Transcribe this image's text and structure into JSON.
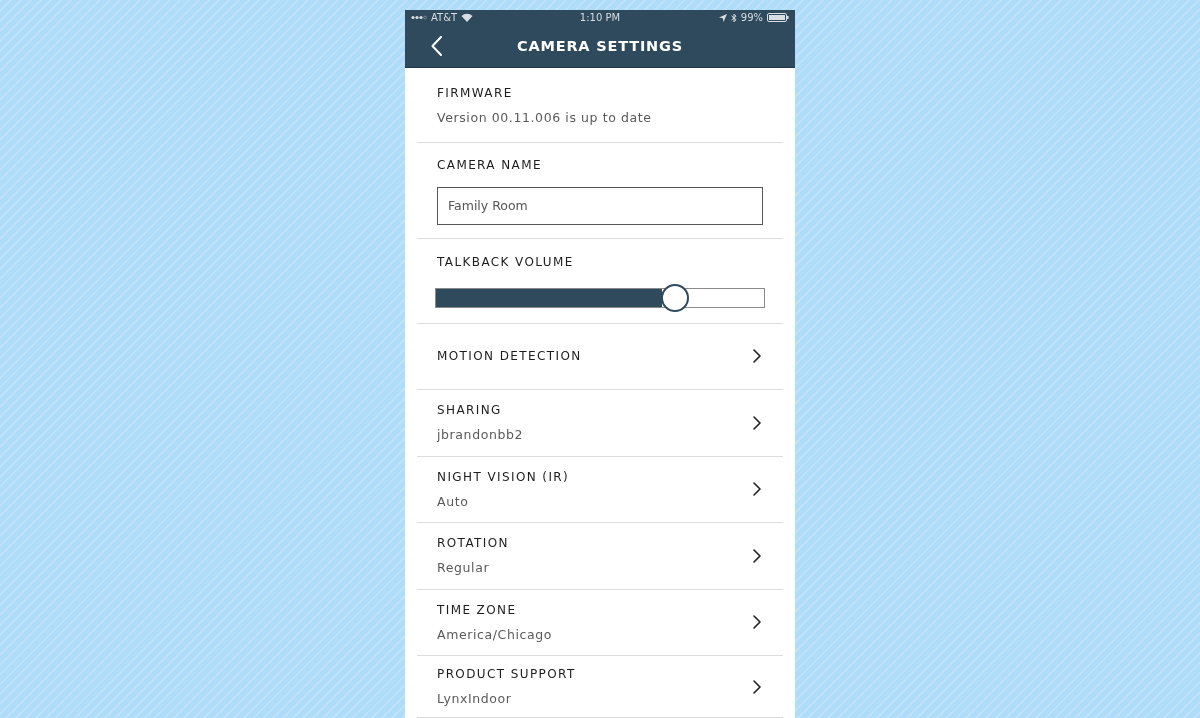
{
  "status_bar": {
    "carrier": "AT&T",
    "time": "1:10 PM",
    "battery": "99%"
  },
  "header": {
    "title": "CAMERA SETTINGS"
  },
  "firmware": {
    "label": "FIRMWARE",
    "value": "Version 00.11.006 is up to date"
  },
  "camera_name": {
    "label": "CAMERA NAME",
    "value": "Family Room"
  },
  "talkback_volume": {
    "label": "TALKBACK VOLUME",
    "level": 0.73
  },
  "menu_items": [
    {
      "label": "MOTION DETECTION"
    },
    {
      "label": "SHARING",
      "value": "jbrandonbb2"
    },
    {
      "label": "NIGHT VISION (IR)",
      "value": "Auto"
    },
    {
      "label": "ROTATION",
      "value": "Regular"
    },
    {
      "label": "TIME ZONE",
      "value": "America/Chicago"
    },
    {
      "label": "PRODUCT SUPPORT",
      "value": "LynxIndoor"
    }
  ]
}
